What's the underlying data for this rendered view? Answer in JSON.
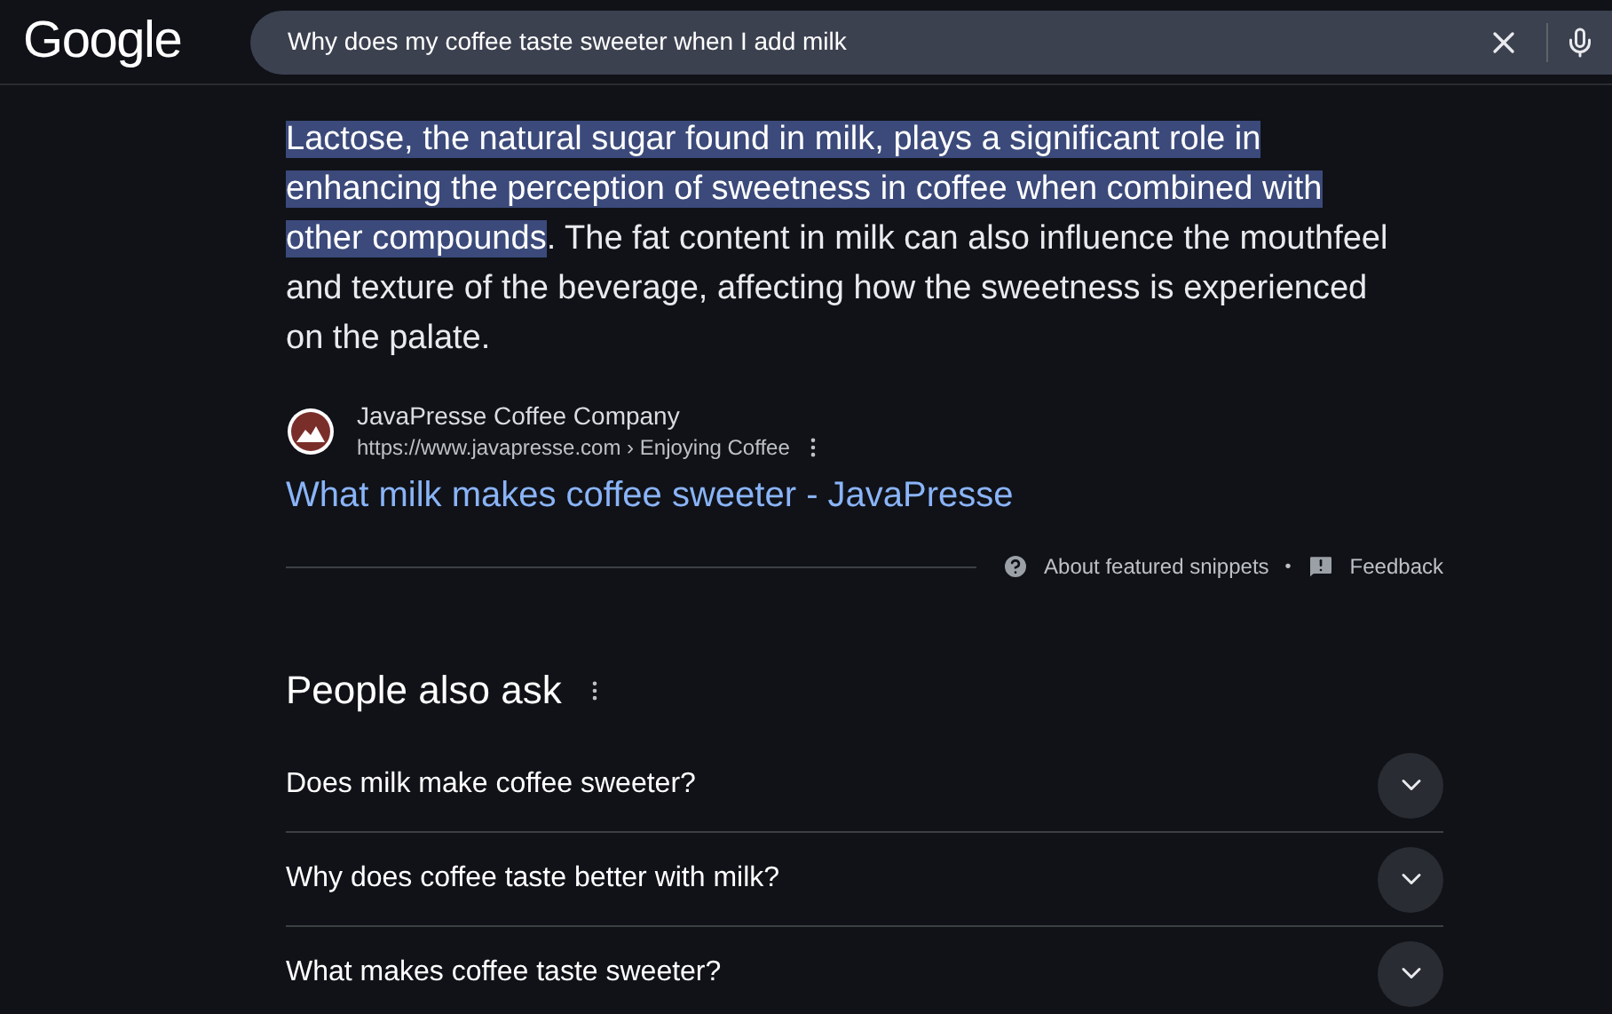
{
  "header": {
    "logo": "Google",
    "search": {
      "value": "Why does my coffee taste sweeter when I add milk"
    }
  },
  "snippet": {
    "highlighted": "Lactose, the natural sugar found in milk, plays a significant role in enhancing the perception of sweetness in coffee when combined with other compounds",
    "text": ". The fat content in milk can also influence the mouthfeel and texture of the beverage, affecting how the sweetness is experienced on the palate."
  },
  "source": {
    "name": "JavaPresse Coffee Company",
    "url": "https://www.javapresse.com › Enjoying Coffee",
    "link": "What milk makes coffee sweeter - JavaPresse"
  },
  "snippet_footer": {
    "about": "About featured snippets",
    "separator": "•",
    "feedback": "Feedback"
  },
  "people_also_ask": {
    "title": "People also ask",
    "questions": [
      {
        "text": "Does milk make coffee sweeter?",
        "expanded": false
      },
      {
        "text": "Why does coffee taste better with milk?",
        "expanded": false
      },
      {
        "text": "What makes coffee taste sweeter?",
        "expanded": false
      }
    ]
  }
}
